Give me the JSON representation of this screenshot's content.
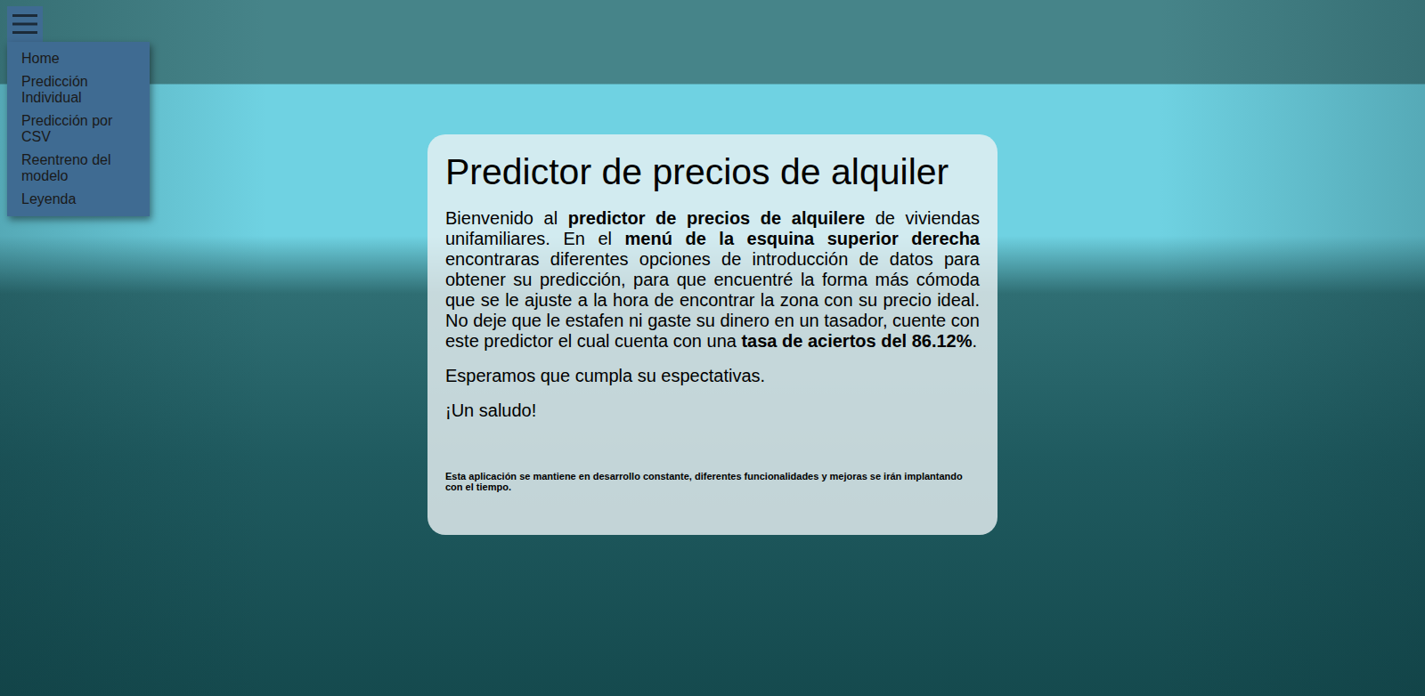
{
  "menu": {
    "items": [
      {
        "label": "Home"
      },
      {
        "label": "Predicción Individual"
      },
      {
        "label": "Predicción por CSV"
      },
      {
        "label": "Reentreno del modelo"
      },
      {
        "label": "Leyenda"
      }
    ]
  },
  "card": {
    "title": "Predictor de precios de alquiler",
    "intro": [
      {
        "text": "Bienvenido al ",
        "bold": false
      },
      {
        "text": "predictor de precios de alquilere",
        "bold": true
      },
      {
        "text": " de viviendas unifamiliares. En el ",
        "bold": false
      },
      {
        "text": "menú de la esquina superior derecha",
        "bold": true
      },
      {
        "text": " encontraras diferentes opciones de introducción de datos para obtener su predicción, para que encuentré la forma más cómoda que se le ajuste a la hora de encontrar la zona con su precio ideal. No deje que le estafen ni gaste su dinero en un tasador, cuente con este predictor el cual cuenta con una ",
        "bold": false
      },
      {
        "text": "tasa de aciertos del 86.12%",
        "bold": true
      },
      {
        "text": ".",
        "bold": false
      }
    ],
    "paragraphs": [
      "Esperamos que cumpla su espectativas.",
      "¡Un saludo!"
    ],
    "note": "Esta aplicación se mantiene en desarrollo constante, diferentes funcionalidades y mejoras se irán implantando con el tiempo."
  }
}
